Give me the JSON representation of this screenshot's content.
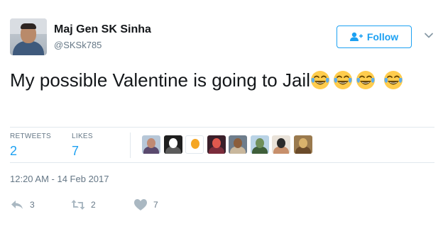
{
  "author": {
    "name": "Maj Gen SK Sinha",
    "handle": "@SKSk785"
  },
  "follow_button": {
    "label": "Follow",
    "icon": "add-user-icon"
  },
  "tweet": {
    "text": "My possible Valentine is going to Jail",
    "emojis": [
      "face-with-tears-of-joy",
      "face-with-tears-of-joy",
      "face-with-tears-of-joy",
      "face-with-tears-of-joy"
    ]
  },
  "stats": {
    "retweets_label": "RETWEETS",
    "retweets_count": "2",
    "likes_label": "LIKES",
    "likes_count": "7"
  },
  "likers_count": 8,
  "timestamp": "12:20 AM - 14 Feb 2017",
  "actions": {
    "reply_count": "3",
    "retweet_count": "2",
    "like_count": "7"
  },
  "colors": {
    "accent": "#1da1f2",
    "muted": "#657786",
    "text": "#14171a",
    "divider": "#e1e8ed"
  }
}
